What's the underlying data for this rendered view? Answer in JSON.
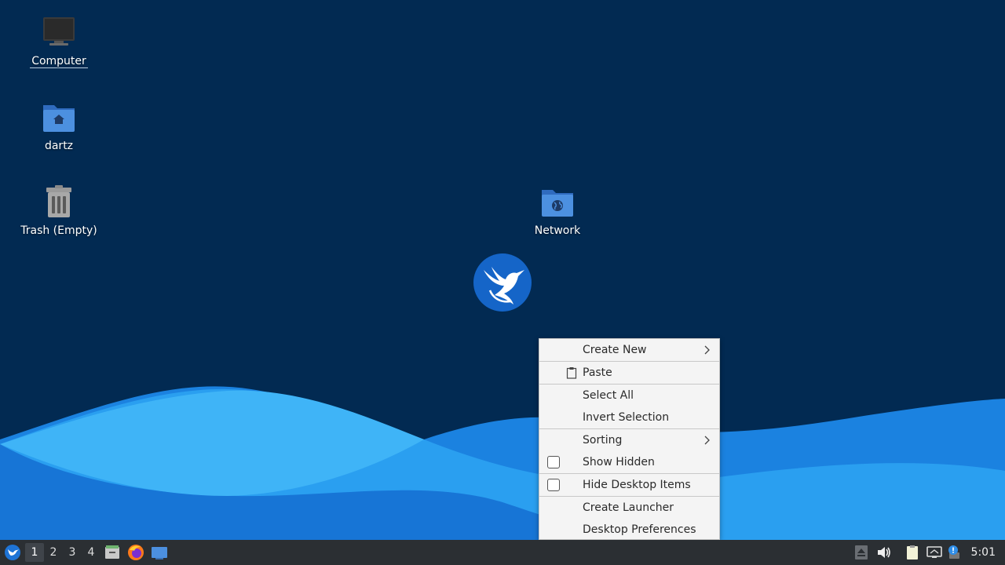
{
  "desktop": {
    "icons": [
      {
        "label": "Computer",
        "icon": "computer-icon"
      },
      {
        "label": "dartz",
        "icon": "home-folder-icon"
      },
      {
        "label": "Trash (Empty)",
        "icon": "trash-icon"
      },
      {
        "label": "Network",
        "icon": "network-folder-icon"
      }
    ],
    "logo": "hummingbird-logo-icon"
  },
  "context_menu": {
    "items": [
      {
        "label": "Create New",
        "submenu": true
      },
      {
        "label": "Paste",
        "icon": "clipboard-icon"
      },
      {
        "label": "Select All"
      },
      {
        "label": "Invert Selection"
      },
      {
        "label": "Sorting",
        "submenu": true
      },
      {
        "label": "Show Hidden",
        "checkbox": false
      },
      {
        "label": "Hide Desktop Items",
        "checkbox": false
      },
      {
        "label": "Create Launcher"
      },
      {
        "label": "Desktop Preferences"
      }
    ]
  },
  "taskbar": {
    "menu_icon": "start-menu-icon",
    "workspaces": [
      "1",
      "2",
      "3",
      "4"
    ],
    "active_workspace": "1",
    "launchers": [
      "file-manager-icon",
      "firefox-icon",
      "show-desktop-icon"
    ],
    "tray_icons": [
      "eject-icon",
      "volume-icon",
      "clipboard-manager-icon",
      "network-icon",
      "update-notifier-icon"
    ],
    "clock": "5:01"
  },
  "colors": {
    "background": "#022a52",
    "wave_light": "#3fb4f7",
    "wave_dark": "#1b82e0",
    "taskbar": "#2b2f33",
    "menu_bg": "#f4f4f4"
  }
}
